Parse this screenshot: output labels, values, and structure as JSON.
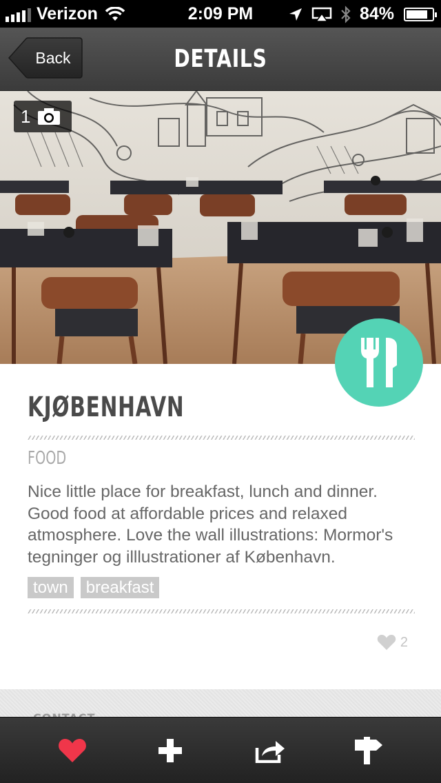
{
  "status_bar": {
    "carrier": "Verizon",
    "time": "2:09 PM",
    "battery": "84%",
    "battery_level": 0.84,
    "icons": [
      "signal-icon",
      "wifi-icon",
      "location-icon",
      "airplay-icon",
      "bluetooth-icon",
      "battery-icon"
    ]
  },
  "nav": {
    "back_label": "Back",
    "title": "DETAILS"
  },
  "hero": {
    "photo_count": "1",
    "photo_icon": "camera-icon"
  },
  "place": {
    "title": "KJØBENHAVN",
    "category": "FOOD",
    "category_icon": "fork-knife-icon",
    "description": "Nice little place for breakfast, lunch and dinner. Good food at affordable prices and relaxed atmosphere. Love the wall illustrations: Mormor's tegninger og illlustrationer af København.",
    "tags": [
      "town",
      "breakfast"
    ],
    "likes": "2"
  },
  "lower": {
    "section_label": "CONTACT"
  },
  "tab_bar": {
    "items": [
      "heart-icon",
      "plus-icon",
      "share-icon",
      "signpost-icon"
    ]
  },
  "colors": {
    "accent": "#54d3b5",
    "like_red": "#f0364a",
    "nav_dark": "#3b3b3b"
  }
}
